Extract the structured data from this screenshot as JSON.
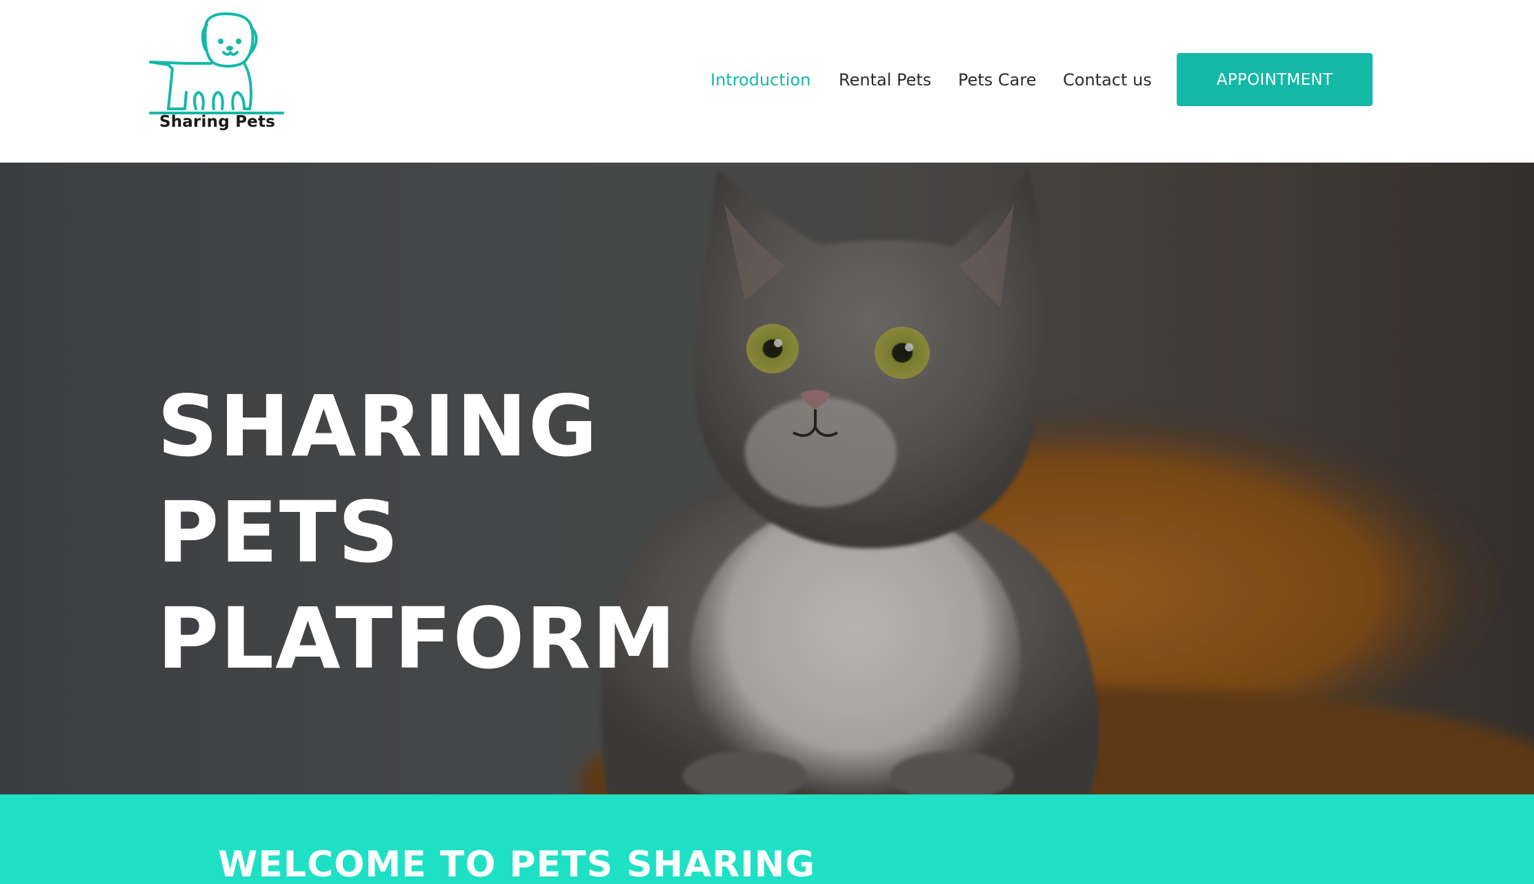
{
  "brand": {
    "logo_text": "Sharing Pets",
    "accent_color": "#14b8a6",
    "band_color": "#1ee0c4",
    "logo_icon": "dog-icon"
  },
  "nav": {
    "items": [
      {
        "label": "Introduction",
        "active": true
      },
      {
        "label": "Rental Pets",
        "active": false
      },
      {
        "label": "Pets Care",
        "active": false
      },
      {
        "label": "Contact us",
        "active": false
      }
    ],
    "cta_label": "APPOINTMENT"
  },
  "hero": {
    "title_line1": "SHARING PETS",
    "title_line2": "PLATFORM",
    "image_subject": "cat-photo"
  },
  "welcome": {
    "title": "WELCOME TO PETS SHARING"
  }
}
